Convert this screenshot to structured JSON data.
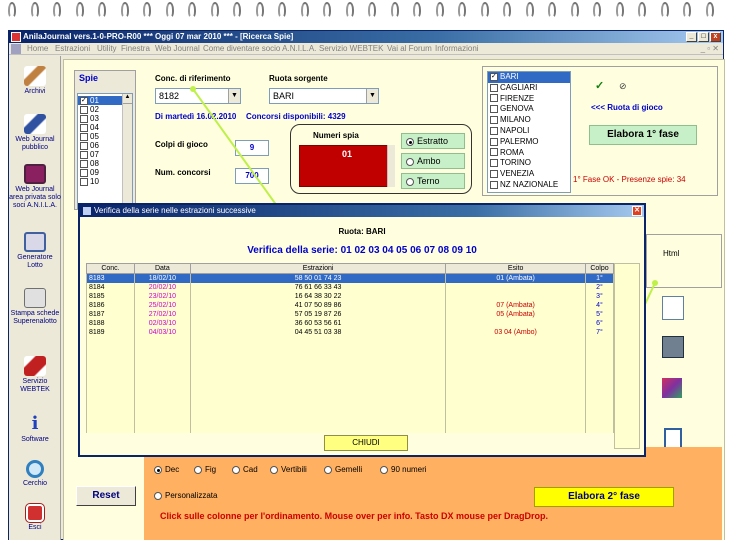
{
  "window": {
    "title": "AnilaJournal vers.1-0-PRO-R00  ***  Oggi 07 mar 2010  ***  - [Ricerca Spie]",
    "menu": [
      "Home",
      "Estrazioni",
      "Utility",
      "Finestra",
      "Web Journal",
      "Come diventare socio A.N.I.L.A.",
      "Servizio WEBTEK",
      "Vai al Forum",
      "Informazioni"
    ]
  },
  "sidebar": {
    "items": [
      {
        "label": "Archivi",
        "icon": "pencil-icon",
        "color": "#8a6d3b"
      },
      {
        "label": "Web Journal pubblico",
        "icon": "book-icon",
        "color": "#3050a0"
      },
      {
        "label": "Web Journal area privata solo soci A.N.I.L.A.",
        "icon": "private-book-icon",
        "color": "#8a2060"
      },
      {
        "label": "Generatore Lotto",
        "icon": "generator-icon",
        "color": "#4060a0"
      },
      {
        "label": "Stampa schede Superenalotto",
        "icon": "printer-icon",
        "color": "#707070"
      },
      {
        "label": "Servizio WEBTEK",
        "icon": "webtek-icon",
        "color": "#c02020"
      },
      {
        "label": "Software",
        "icon": "info-icon",
        "color": "#2040c0"
      },
      {
        "label": "Cerchio",
        "icon": "circle-icon",
        "color": "#3080c0"
      },
      {
        "label": "Esci",
        "icon": "exit-icon",
        "color": "#c03030"
      }
    ]
  },
  "form": {
    "spie_label": "Spie",
    "spie_list": [
      "01",
      "02",
      "03",
      "04",
      "05",
      "06",
      "07",
      "08",
      "09",
      "10"
    ],
    "conc_label": "Conc. di riferimento",
    "conc_value": "8182",
    "ruota_sorgente_label": "Ruota sorgente",
    "ruota_sorgente_value": "BARI",
    "data_text": "Di  martedì 16.02.2010",
    "concorsi_disp": "Concorsi disponibili: 4329",
    "colpi_label": "Colpi di gioco",
    "colpi_value": "9",
    "num_concorsi_label": "Num. concorsi",
    "num_concorsi_value": "700",
    "numeri_spia_label": "Numeri spia",
    "numeri_spia_value": "01",
    "mode_options": [
      "Estratto",
      "Ambo",
      "Terno"
    ],
    "mode_selected": "Estratto",
    "ruote": [
      "BARI",
      "CAGLIARI",
      "FIRENZE",
      "GENOVA",
      "MILANO",
      "NAPOLI",
      "PALERMO",
      "ROMA",
      "TORINO",
      "VENEZIA",
      "NZ NAZIONALE"
    ],
    "ruota_gioco_label": "<<< Ruota di gioco",
    "elabora1_label": "Elabora 1° fase",
    "fase_status": "1° Fase OK - Presenze spie: 34",
    "html_label": "Html",
    "reset_label": "Reset",
    "sort_options": [
      "Dec",
      "Fig",
      "Cad",
      "Vertibili",
      "Gemelli",
      "90 numeri"
    ],
    "personalizzata_label": "Personalizzata",
    "elabora2_label": "Elabora 2° fase",
    "hint_text": "Click sulle colonne per l'ordinamento. Mouse over per info. Tasto DX mouse per DragDrop."
  },
  "dialog": {
    "title": "Verifica della serie nelle estrazioni successive",
    "ruota_text": "Ruota: BARI",
    "serie_text": "Verifica della serie: 01 02 03 04 05 06 07 08 09 10",
    "columns": [
      "Conc.",
      "Data",
      "Estrazioni",
      "Esito",
      "Colpo"
    ],
    "rows": [
      {
        "conc": "8183",
        "data": "18/02/10",
        "estr": "58 50 01 74 23",
        "esito": "01   (Ambata)",
        "colpo": "1°"
      },
      {
        "conc": "8184",
        "data": "20/02/10",
        "estr": "76 61 66 33 43",
        "esito": "",
        "colpo": "2°"
      },
      {
        "conc": "8185",
        "data": "23/02/10",
        "estr": "16 64 38 30 22",
        "esito": "",
        "colpo": "3°"
      },
      {
        "conc": "8186",
        "data": "25/02/10",
        "estr": "41 07 50 89 86",
        "esito": "07   (Ambata)",
        "colpo": "4°"
      },
      {
        "conc": "8187",
        "data": "27/02/10",
        "estr": "57 05 19 87 26",
        "esito": "05   (Ambata)",
        "colpo": "5°"
      },
      {
        "conc": "8188",
        "data": "02/03/10",
        "estr": "36 60 53 56 61",
        "esito": "",
        "colpo": "6°"
      },
      {
        "conc": "8189",
        "data": "04/03/10",
        "estr": "04 45 51 03 38",
        "esito": "03 04   (Ambo)",
        "colpo": "7°"
      }
    ],
    "close_label": "CHIUDI"
  }
}
